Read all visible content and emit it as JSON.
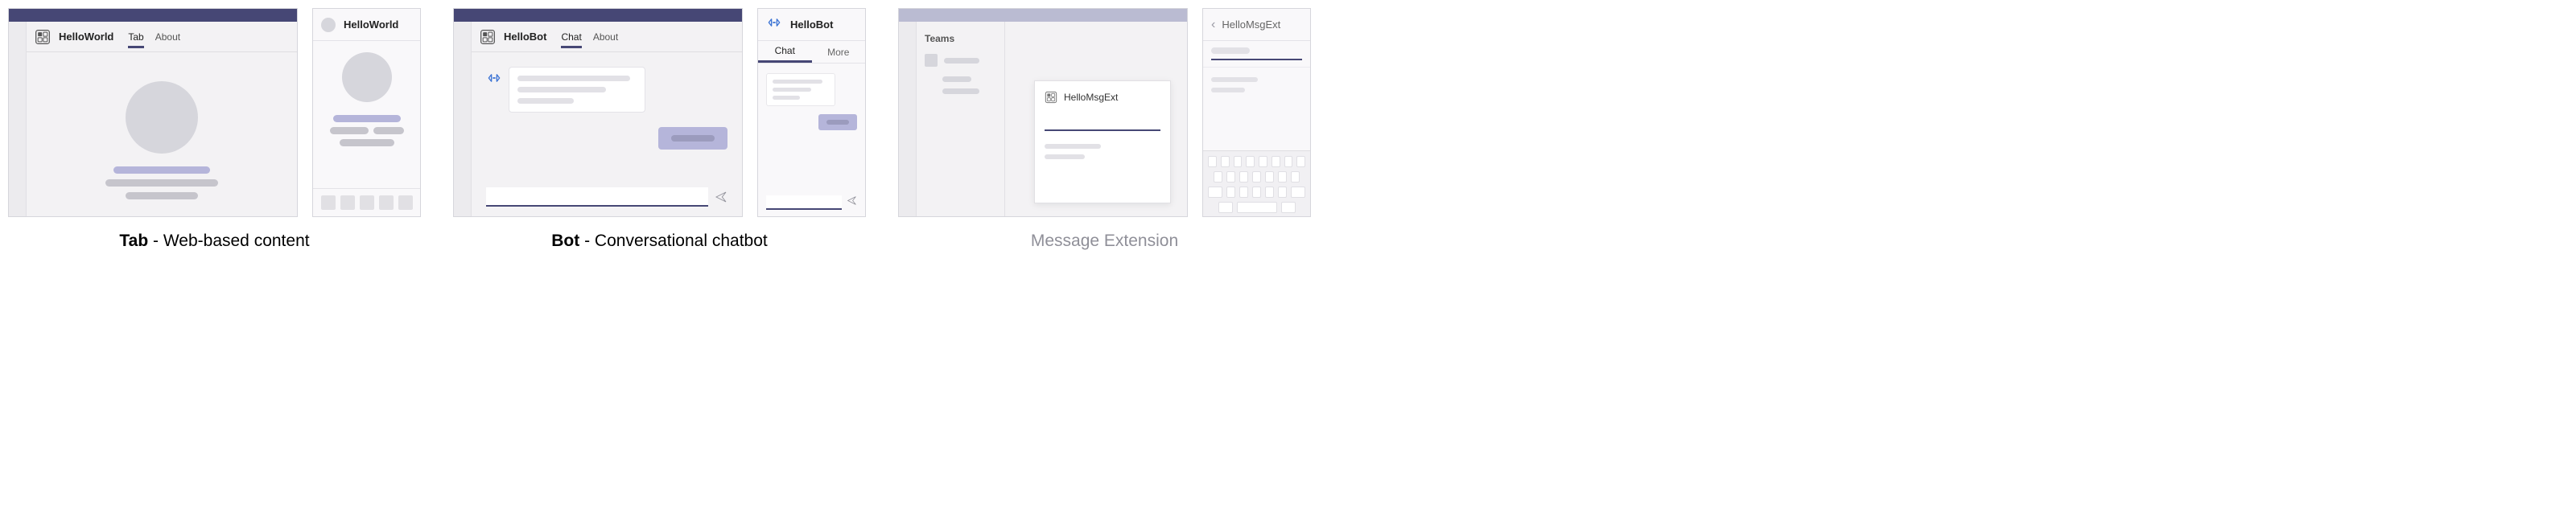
{
  "tab": {
    "caption_bold": "Tab",
    "caption_rest": " - Web-based content",
    "desktop": {
      "app_name": "HelloWorld",
      "tabs": [
        "Tab",
        "About"
      ],
      "active_tab_index": 0
    },
    "mobile": {
      "title": "HelloWorld"
    }
  },
  "bot": {
    "caption_bold": "Bot",
    "caption_rest": " - Conversational chatbot",
    "desktop": {
      "app_name": "HelloBot",
      "tabs": [
        "Chat",
        "About"
      ],
      "active_tab_index": 0
    },
    "mobile": {
      "title": "HelloBot",
      "tabs": [
        "Chat",
        "More"
      ],
      "active_tab_index": 0
    }
  },
  "me": {
    "caption": "Message Extension",
    "desktop": {
      "sidebar_label": "Teams",
      "card_title": "HelloMsgExt"
    },
    "mobile": {
      "title": "HelloMsgExt"
    }
  },
  "icons": {
    "app": "app-icon",
    "bot": "bot-icon",
    "send": "send-icon",
    "back": "chevron-left-icon"
  }
}
